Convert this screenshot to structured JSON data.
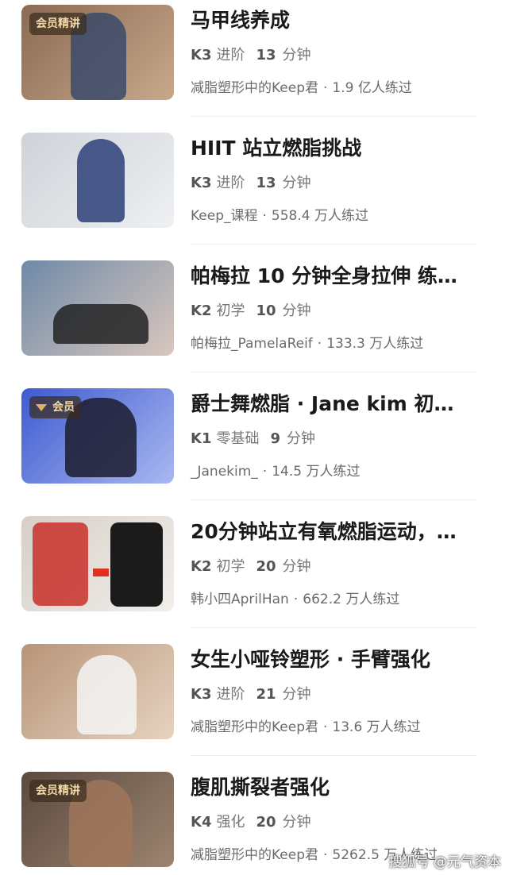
{
  "courses": [
    {
      "title": "马甲线养成",
      "level": "K3",
      "level_tag": "进阶",
      "minutes": "13",
      "unit": "分钟",
      "author": "减脂塑形中的Keep君",
      "dot": "·",
      "trained": "1.9 亿人练过",
      "badge": "会员精讲",
      "thumb_colors": [
        "#8a6a52",
        "#c9a98c"
      ]
    },
    {
      "title": "HIIT 站立燃脂挑战",
      "level": "K3",
      "level_tag": "进阶",
      "minutes": "13",
      "unit": "分钟",
      "author": "Keep_课程",
      "dot": "·",
      "trained": "558.4 万人练过",
      "badge": "",
      "thumb_colors": [
        "#cfd3d8",
        "#eef0f2"
      ]
    },
    {
      "title": "帕梅拉 10 分钟全身拉伸 练…",
      "level": "K2",
      "level_tag": "初学",
      "minutes": "10",
      "unit": "分钟",
      "author": "帕梅拉_PamelaReif",
      "dot": "·",
      "trained": "133.3 万人练过",
      "badge": "",
      "thumb_colors": [
        "#6f8aa8",
        "#d9c7bd"
      ]
    },
    {
      "title": "爵士舞燃脂 · Jane kim 初…",
      "level": "K1",
      "level_tag": "零基础",
      "minutes": "9",
      "unit": "分钟",
      "author": "_Janekim_",
      "dot": "·",
      "trained": "14.5 万人练过",
      "badge": "会员",
      "thumb_colors": [
        "#3e5bd0",
        "#a9b8f0"
      ]
    },
    {
      "title": "20分钟站立有氧燃脂运动，…",
      "level": "K2",
      "level_tag": "初学",
      "minutes": "20",
      "unit": "分钟",
      "author": "韩小四AprilHan",
      "dot": "·",
      "trained": "662.2 万人练过",
      "badge": "",
      "thumb_colors": [
        "#d6cfc8",
        "#f2eeea"
      ]
    },
    {
      "title": "女生小哑铃塑形 · 手臂强化",
      "level": "K3",
      "level_tag": "进阶",
      "minutes": "21",
      "unit": "分钟",
      "author": "减脂塑形中的Keep君",
      "dot": "·",
      "trained": "13.6 万人练过",
      "badge": "",
      "thumb_colors": [
        "#b89478",
        "#e6d3c0"
      ]
    },
    {
      "title": "腹肌撕裂者强化",
      "level": "K4",
      "level_tag": "强化",
      "minutes": "20",
      "unit": "分钟",
      "author": "减脂塑形中的Keep君",
      "dot": "·",
      "trained": "5262.5 万人练过",
      "badge": "会员精讲",
      "thumb_colors": [
        "#5b4a3f",
        "#9c8470"
      ]
    }
  ],
  "watermark": "搜狐号 @元气资本"
}
